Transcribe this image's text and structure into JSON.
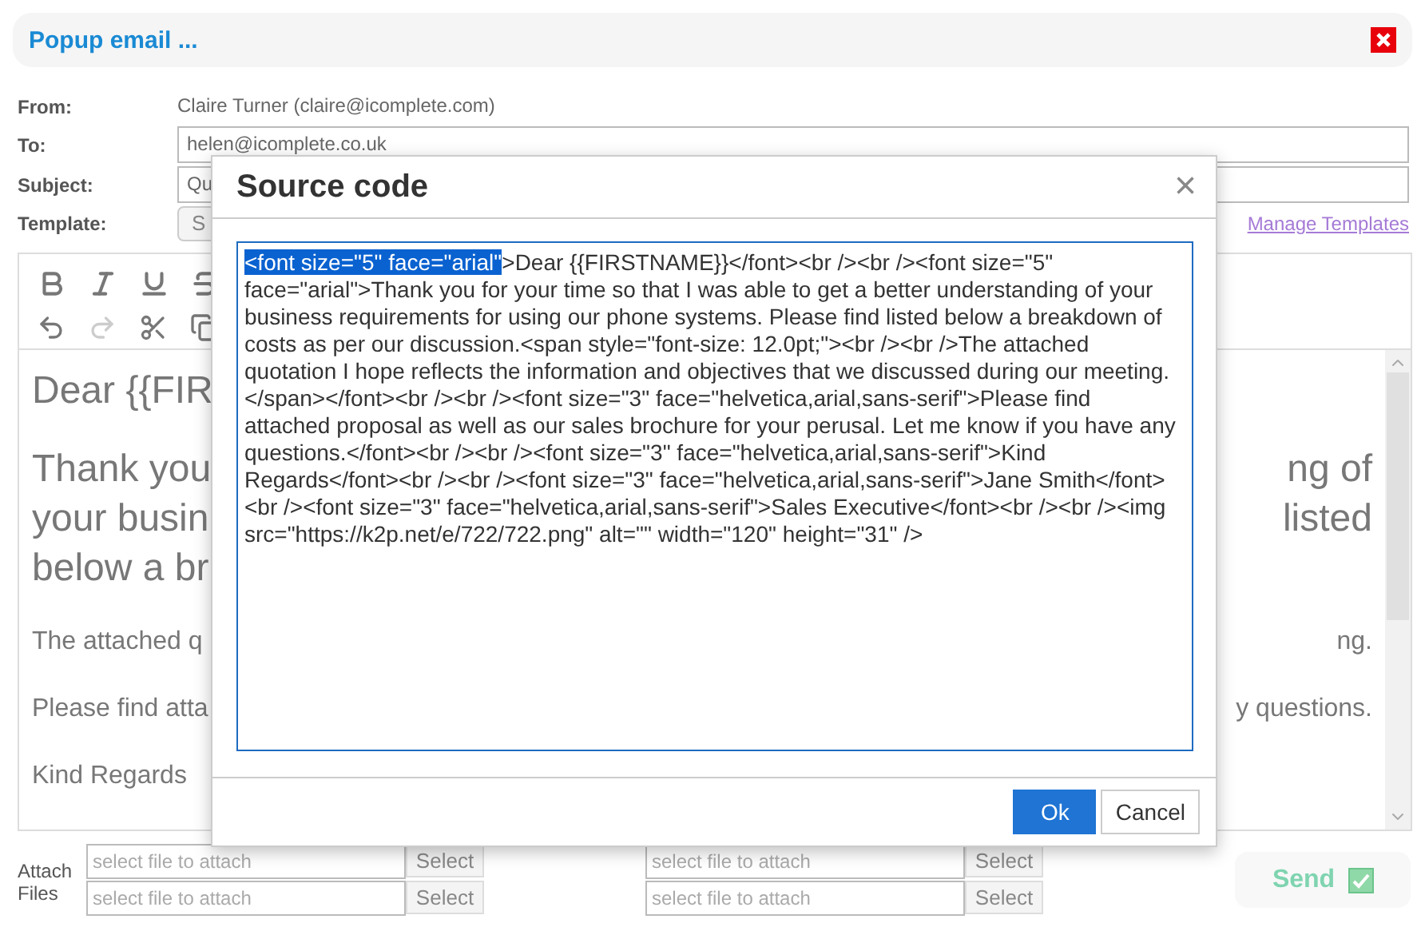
{
  "window": {
    "title": "Popup email ..."
  },
  "form": {
    "from_label": "From:",
    "from_value": "Claire Turner (claire@icomplete.com)",
    "to_label": "To:",
    "to_value": "helen@icomplete.co.uk",
    "subject_label": "Subject:",
    "subject_value": "Qu",
    "template_label": "Template:",
    "template_value": "S",
    "manage_templates": "Manage Templates"
  },
  "toolbar": [
    {
      "kind": "bold",
      "disabled": false
    },
    {
      "kind": "italic",
      "disabled": false
    },
    {
      "kind": "underline",
      "disabled": false
    },
    {
      "kind": "strike",
      "disabled": false
    },
    {
      "kind": "undo",
      "disabled": false
    },
    {
      "kind": "redo",
      "disabled": true
    },
    {
      "kind": "cut",
      "disabled": false
    },
    {
      "kind": "copy",
      "disabled": false
    }
  ],
  "editor": {
    "paragraphs": [
      {
        "kind": "large",
        "lines": [
          {
            "left": "Dear {{FIR"
          }
        ]
      },
      {
        "kind": "large",
        "lines": [
          {
            "left": "Thank you",
            "right": "ng of"
          },
          {
            "left": "your busin",
            "right": "listed"
          },
          {
            "left": "below a br"
          }
        ]
      },
      {
        "kind": "body",
        "lines": [
          {
            "left": "The attached q",
            "right": "ng."
          }
        ]
      },
      {
        "kind": "body",
        "lines": [
          {
            "left": "Please find atta",
            "right": "y questions."
          }
        ]
      },
      {
        "kind": "body",
        "lines": [
          {
            "left": "Kind Regards"
          }
        ]
      }
    ]
  },
  "attach": {
    "label": "Attach Files",
    "slots": [
      {
        "placeholder": "select file to attach",
        "button": "Select"
      },
      {
        "placeholder": "select file to attach",
        "button": "Select"
      },
      {
        "placeholder": "select file to attach",
        "button": "Select"
      },
      {
        "placeholder": "select file to attach",
        "button": "Select"
      }
    ]
  },
  "send_button": "Send",
  "dialog": {
    "title": "Source code",
    "close": "×",
    "selected_text": "<font size=\"5\" face=\"arial\"",
    "text": ">Dear {{FIRSTNAME}}</font><br /><br /><font size=\"5\" face=\"arial\">Thank you for your time so that I was able to get a better understanding of your business requirements for using our phone systems. Please find listed below a breakdown of costs as per our discussion.<span style=\"font-size: 12.0pt;\"><br /><br />The attached quotation I hope reflects the information and objectives that we discussed during our meeting.</span></font><br /><br /><font size=\"3\" face=\"helvetica,arial,sans-serif\">Please find attached proposal as well as our sales brochure for your perusal. Let me know if you have any questions.</font><br /><br /><font size=\"3\" face=\"helvetica,arial,sans-serif\">Kind Regards</font><br /><br /><font size=\"3\" face=\"helvetica,arial,sans-serif\">Jane Smith</font><br /><font size=\"3\" face=\"helvetica,arial,sans-serif\">Sales Executive</font><br /><br /><img src=\"https://k2p.net/e/722/722.png\" alt=\"\" width=\"120\" height=\"31\" />",
    "buttons": [
      {
        "label": "Ok",
        "kind": "primary"
      },
      {
        "label": "Cancel",
        "kind": "secondary"
      }
    ]
  }
}
